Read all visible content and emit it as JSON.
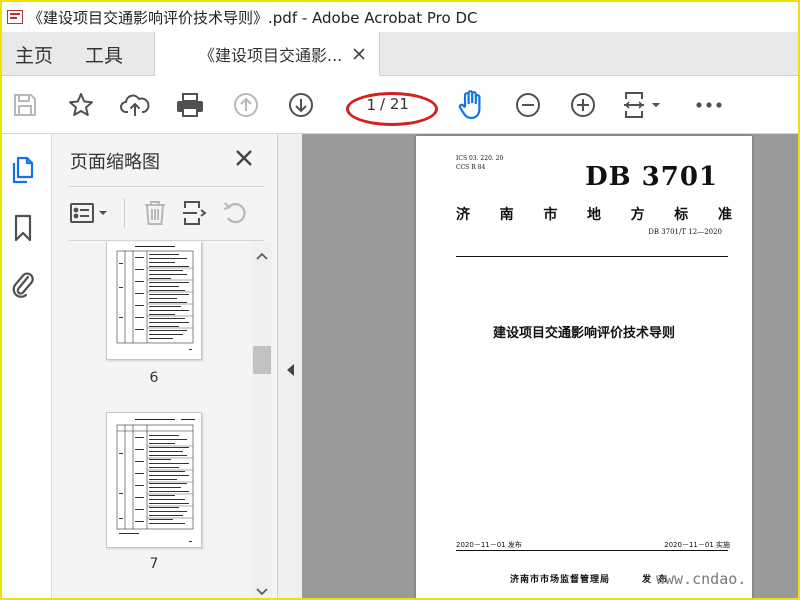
{
  "window": {
    "title": "《建设项目交通影响评价技术导则》.pdf - Adobe Acrobat Pro DC"
  },
  "tabs": {
    "home": "主页",
    "tools": "工具",
    "document": "《建设项目交通影...",
    "close_symbol": "×"
  },
  "toolbar": {
    "icons": [
      "save-icon",
      "star-icon",
      "cloud-upload-icon",
      "print-icon",
      "arrow-up-circle-icon",
      "arrow-down-circle-icon",
      "hand-icon",
      "zoom-out-icon",
      "zoom-in-icon",
      "fit-page-icon",
      "more-icon"
    ],
    "current_page": "1",
    "total_pages": "/ 21",
    "highlight_color": "#d42020",
    "accent_color": "#1473e6"
  },
  "side_rail": {
    "icons": [
      "pages-icon",
      "bookmark-icon",
      "attachment-icon"
    ]
  },
  "thumbnails_panel": {
    "title": "页面缩略图",
    "close_symbol": "✕",
    "pages": [
      {
        "label": "6"
      },
      {
        "label": "7"
      }
    ]
  },
  "document_page": {
    "ics": "ICS  03. 220. 20",
    "ccs": "CCS  R  84",
    "code": "DB 3701",
    "standard_type": [
      "济",
      "南",
      "市",
      "地",
      "方",
      "标",
      "准"
    ],
    "standard_number": "DB 3701/T 12—2020",
    "main_title": "建设项目交通影响评价技术导则",
    "release_date": "2020－11－01 发布",
    "implement_date": "2020－11－01 实施",
    "issuer": "济南市市场监督管理局",
    "issue_word": "发 布"
  },
  "watermark": "www.cndao."
}
